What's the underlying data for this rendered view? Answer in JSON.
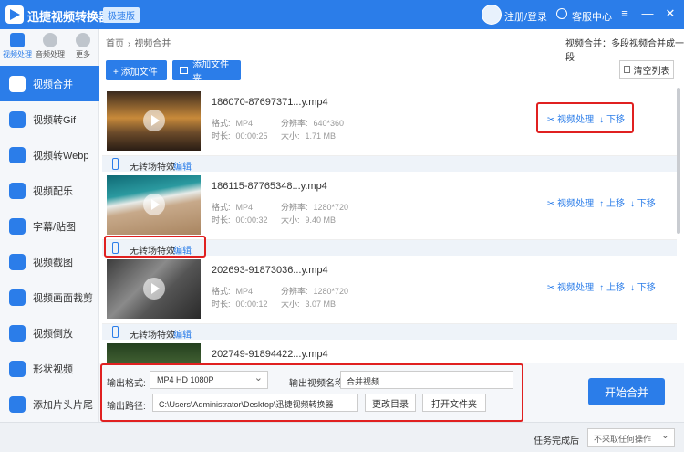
{
  "app": {
    "title": "迅捷视频转换器",
    "edition": "极速版",
    "login": "注册/登录",
    "service": "客服中心",
    "min": "—",
    "max": "□",
    "close": "✕"
  },
  "tabs": [
    {
      "label": "视频处理",
      "active": true
    },
    {
      "label": "音频处理"
    },
    {
      "label": "更多"
    }
  ],
  "menu": [
    {
      "label": "视频合并",
      "active": true
    },
    {
      "label": "视频转Gif"
    },
    {
      "label": "视频转Webp"
    },
    {
      "label": "视频配乐"
    },
    {
      "label": "字幕/贴图"
    },
    {
      "label": "视频截图"
    },
    {
      "label": "视频画面裁剪"
    },
    {
      "label": "视频倒放"
    },
    {
      "label": "形状视频"
    },
    {
      "label": "添加片头片尾"
    }
  ],
  "breadcrumb": {
    "home": "首页",
    "sep": "›",
    "current": "视频合并",
    "desc": "视频合并：多段视频合并成一段"
  },
  "toolbar": {
    "add_file": "+ 添加文件",
    "add_folder": "添加文件夹",
    "clear": "清空列表"
  },
  "labels": {
    "format": "格式:",
    "duration": "时长:",
    "resolution": "分辨率:",
    "size": "大小:",
    "process": "视频处理",
    "up": "↑ 上移",
    "down": "↓ 下移",
    "no_transition": "无转场特效",
    "edit": "编辑"
  },
  "items": [
    {
      "name": "186070-87697371...y.mp4",
      "format": "MP4",
      "duration": "00:00:25",
      "resolution": "640*360",
      "size": "1.71 MB",
      "has_up": false
    },
    {
      "name": "186115-87765348...y.mp4",
      "format": "MP4",
      "duration": "00:00:32",
      "resolution": "1280*720",
      "size": "9.40 MB",
      "has_up": true
    },
    {
      "name": "202693-91873036...y.mp4",
      "format": "MP4",
      "duration": "00:00:12",
      "resolution": "1280*720",
      "size": "3.07 MB",
      "has_up": true
    },
    {
      "name": "202749-91894422...y.mp4",
      "format": "",
      "duration": "",
      "resolution": "",
      "size": "",
      "has_up": true
    }
  ],
  "output": {
    "format_label": "输出格式:",
    "format_value": "MP4  HD 1080P",
    "name_label": "输出视频名称",
    "name_value": "合并视频",
    "path_label": "输出路径:",
    "path_value": "C:\\Users\\Administrator\\Desktop\\迅捷视频转换器",
    "change_dir": "更改目录",
    "open_folder": "打开文件夹",
    "start": "开始合并"
  },
  "status": {
    "label": "任务完成后",
    "option": "不采取任何操作"
  },
  "colors": {
    "accent": "#2b7de9",
    "highlight": "#e02020"
  }
}
